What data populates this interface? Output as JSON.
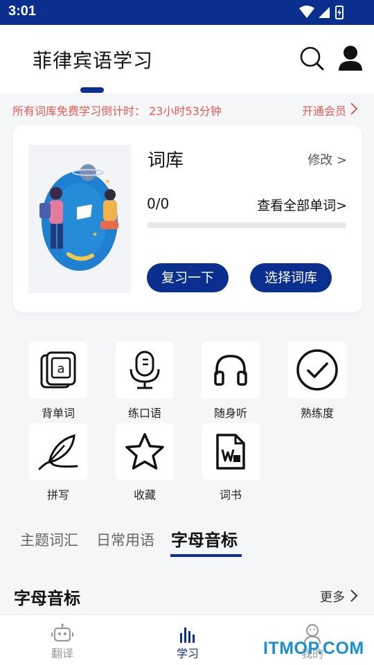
{
  "status_bar": {
    "time": "3:01"
  },
  "header": {
    "title": "菲律宾语学习"
  },
  "notice": {
    "text": "所有词库免费学习倒计时： 23小时53分钟",
    "member_link": "开通会员"
  },
  "library_card": {
    "title": "词库",
    "edit_label": "修改 >",
    "count": "0/0",
    "view_all_label": "查看全部单词>",
    "progress_fraction": 0,
    "review_button": "复习一下",
    "choose_button": "选择词库"
  },
  "features": [
    {
      "label": "背单词",
      "icon": "flashcard-icon"
    },
    {
      "label": "练口语",
      "icon": "microphone-icon"
    },
    {
      "label": "随身听",
      "icon": "headphones-icon"
    },
    {
      "label": "熟练度",
      "icon": "checkmark-circle-icon"
    },
    {
      "label": "拼写",
      "icon": "feather-pen-icon"
    },
    {
      "label": "收藏",
      "icon": "star-icon"
    },
    {
      "label": "词书",
      "icon": "word-document-icon"
    }
  ],
  "tabs": [
    {
      "label": "主题词汇"
    },
    {
      "label": "日常用语"
    },
    {
      "label": "字母音标",
      "active": true
    }
  ],
  "section": {
    "title": "字母音标",
    "more_label": "更多"
  },
  "bottom_nav": [
    {
      "label": "翻译",
      "icon": "robot-icon"
    },
    {
      "label": "学习",
      "icon": "bar-chart-icon",
      "active": true
    },
    {
      "label": "我的",
      "icon": "profile-icon"
    }
  ],
  "watermark": "ITMOP.COM",
  "colors": {
    "primary": "#0a2f8f",
    "notice": "#e25b4f",
    "watermark": "#1a8fd6"
  }
}
